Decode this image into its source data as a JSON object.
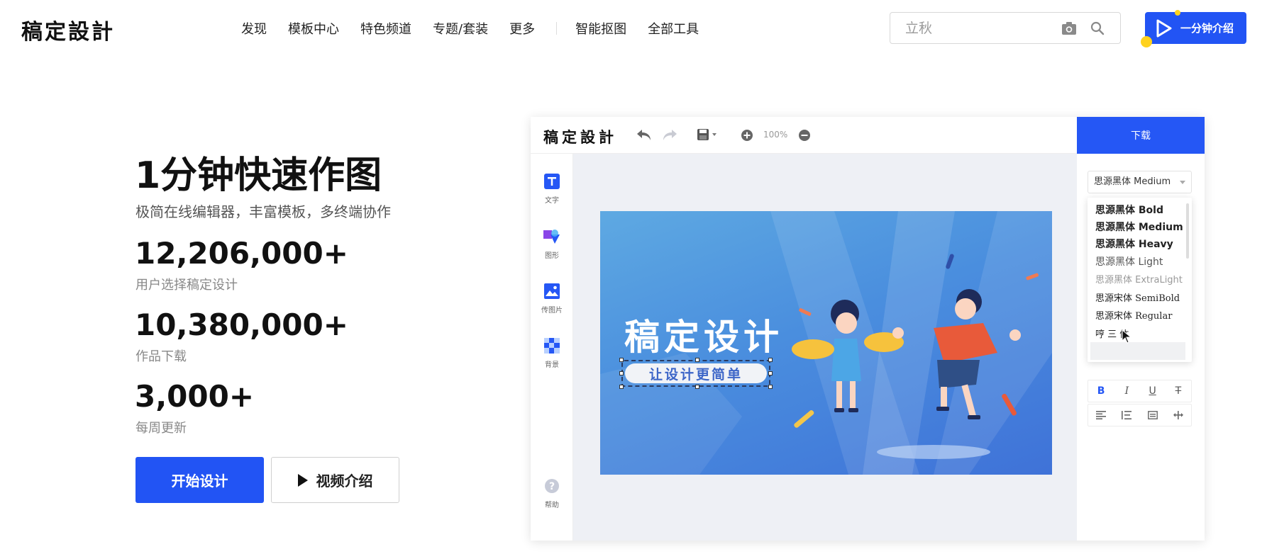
{
  "nav": {
    "logo": "稿定設計",
    "menu": [
      "发现",
      "模板中心",
      "特色频道",
      "专题/套装",
      "更多"
    ],
    "menu_right": [
      "智能抠图",
      "全部工具"
    ],
    "search_placeholder": "立秋",
    "intro_button": "一分钟介绍"
  },
  "hero": {
    "title": "1分钟快速作图",
    "subtitle": "极简在线编辑器，丰富模板，多终端协作",
    "stats": [
      {
        "number": "12,206,000+",
        "label": "用户选择稿定设计"
      },
      {
        "number": "10,380,000+",
        "label": "作品下载"
      },
      {
        "number": "3,000+",
        "label": "每周更新"
      }
    ],
    "start_button": "开始设计",
    "video_button": "视频介绍"
  },
  "editor": {
    "logo": "稿定設計",
    "zoom": "100%",
    "download": "下载",
    "left_tools": [
      {
        "label": "文字",
        "icon": "text-icon"
      },
      {
        "label": "图形",
        "icon": "shape-icon"
      },
      {
        "label": "传图片",
        "icon": "image-icon"
      },
      {
        "label": "背景",
        "icon": "background-icon"
      }
    ],
    "help": "帮助",
    "art_title": "稿定设计",
    "art_subtitle": "让设计更简单",
    "font_selected": "思源黑体 Medium",
    "fonts": [
      "思源黑体 Bold",
      "思源黑体 Medium",
      "思源黑体 Heavy",
      "思源黑体 Light",
      "思源黑体 ExtraLight",
      "思源宋体 SemiBold",
      "思源宋体 Regular",
      "哼 三 体"
    ],
    "format_row1": [
      "B",
      "I",
      "U",
      "T"
    ],
    "colors": {
      "accent": "#2254f4",
      "download": "#2557f5"
    }
  }
}
